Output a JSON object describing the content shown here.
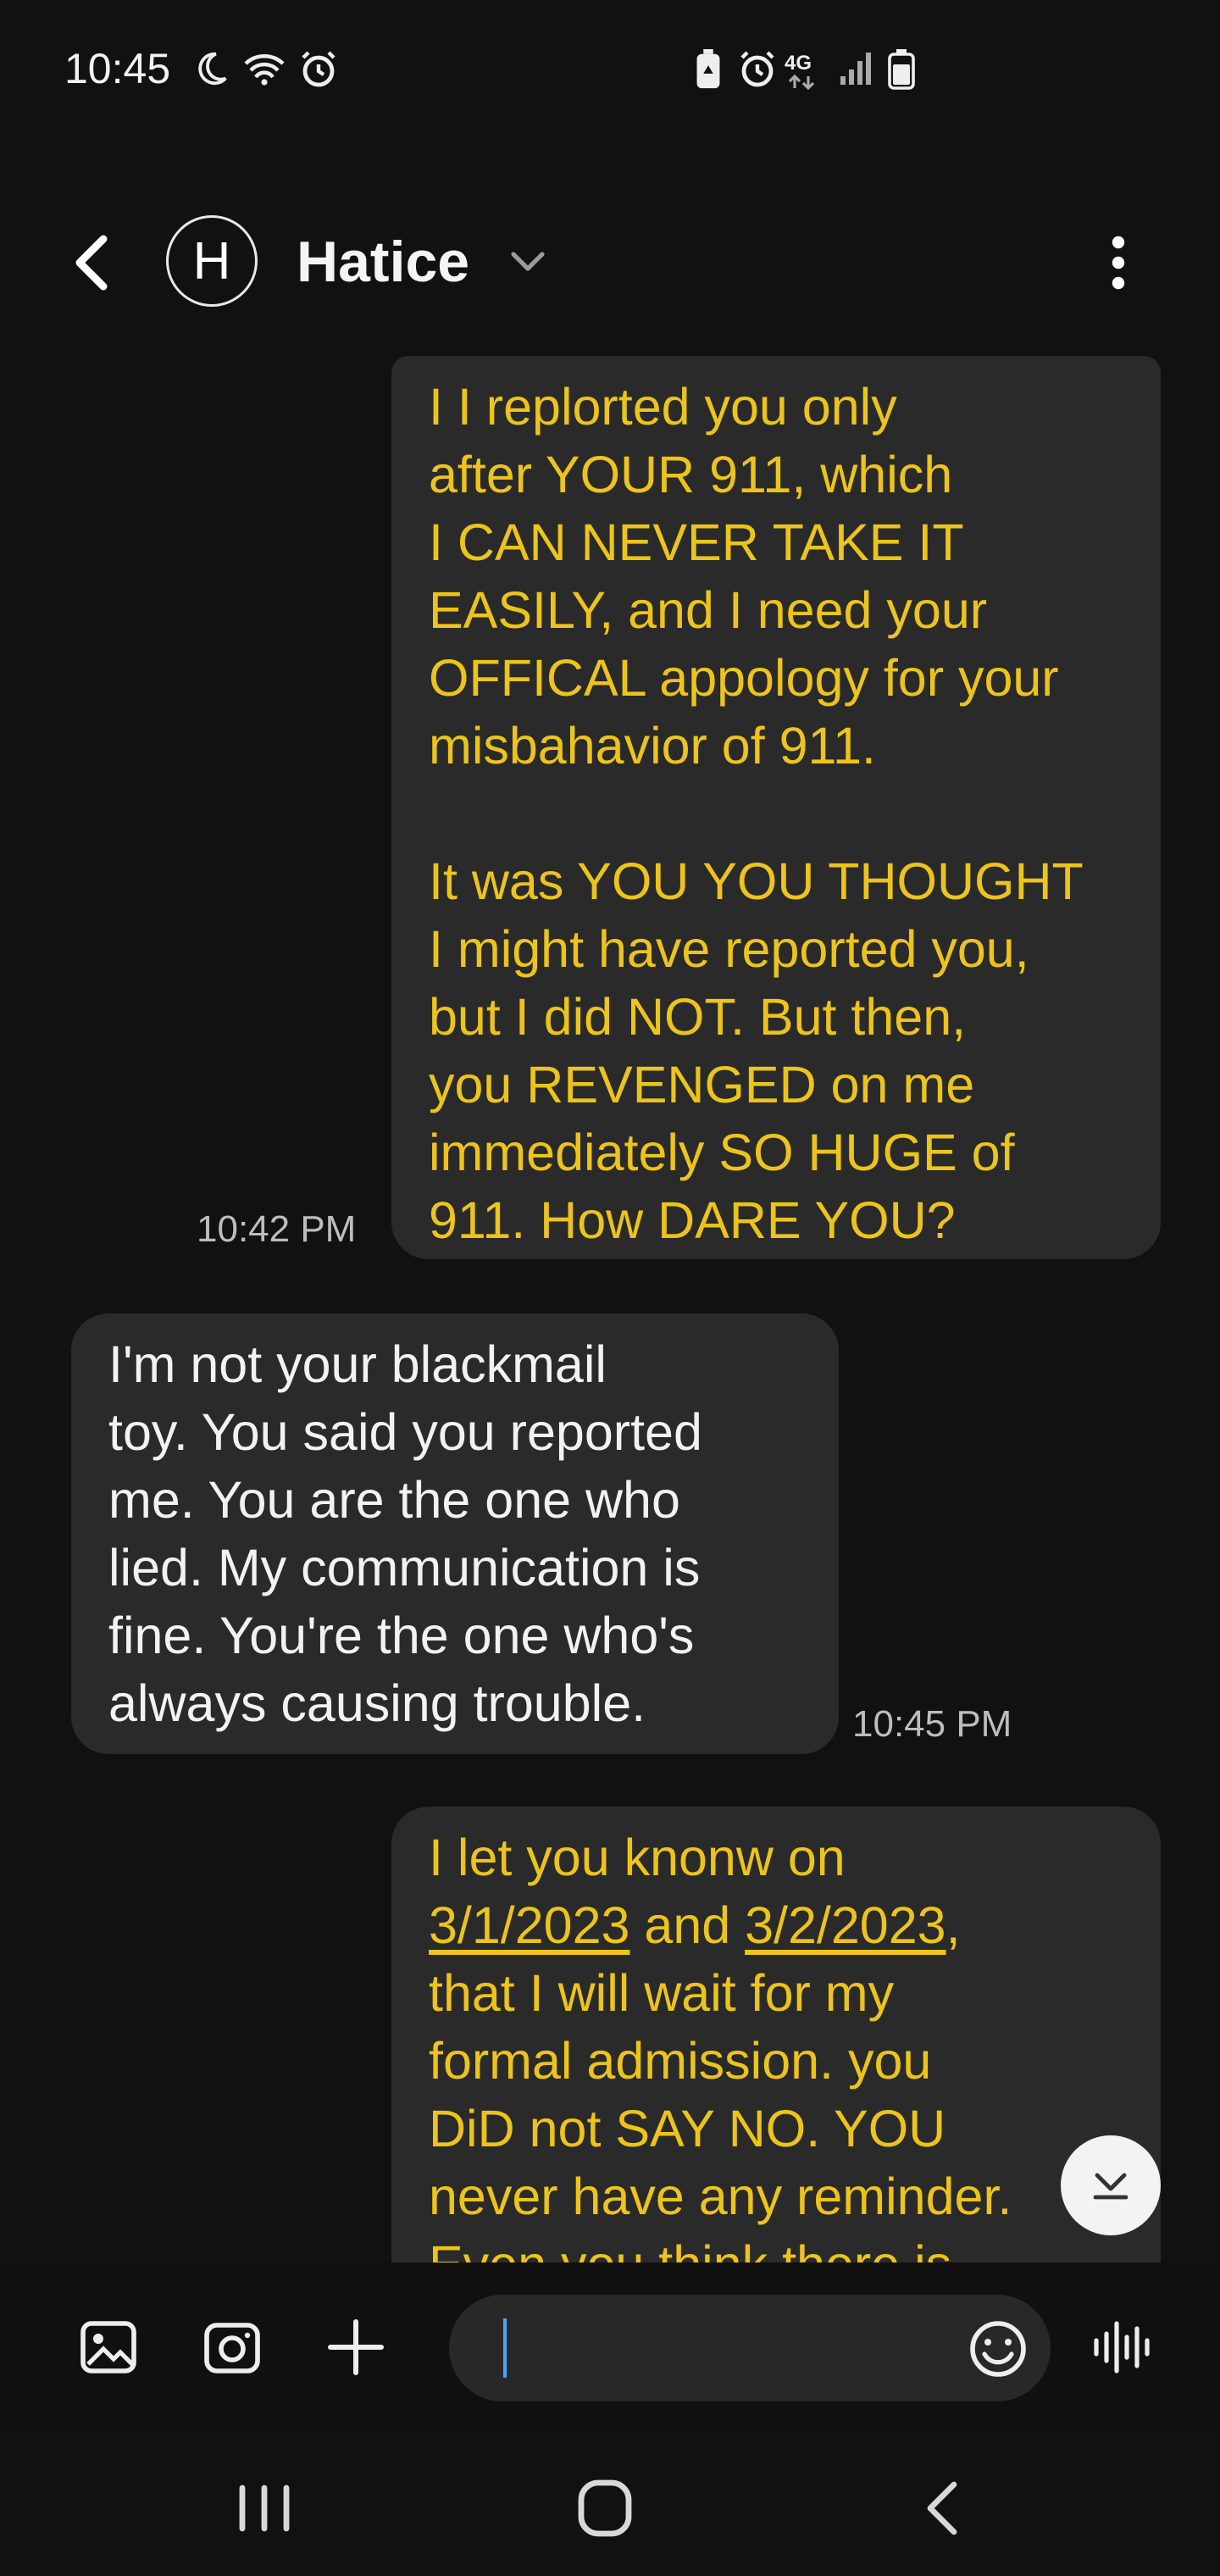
{
  "status_bar": {
    "time": "10:45",
    "left_icons": [
      "moon-icon",
      "wifi-icon",
      "alarm-icon"
    ],
    "right_icons": [
      "battery-saver-icon",
      "alarm-icon",
      "4g-icon",
      "signal-icon",
      "battery-icon"
    ]
  },
  "header": {
    "avatar_initial": "H",
    "contact_name": "Hatice"
  },
  "messages": [
    {
      "direction": "sent",
      "text": "I I replorted you only\nafter YOUR 911, which\nI CAN NEVER TAKE IT\nEASILY, and I need your\nOFFICAL appology for your\nmisbahavior of 911.\n\nIt was YOU YOU THOUGHT\nI might have reported you,\nbut I did NOT. But then,\nyou REVENGED on me\nimmediately SO HUGE of\n911. How DARE YOU?",
      "time": "10:42 PM"
    },
    {
      "direction": "received",
      "text": "I'm not your blackmail\ntoy. You said you reported\nme. You are the one who\nlied. My communication is\nfine. You're the one who's\nalways causing trouble.",
      "time": "10:45 PM"
    },
    {
      "direction": "sent",
      "text_parts": {
        "p1": "I let you knonw on\n",
        "date1": "3/1/2023",
        "p2": " and ",
        "date2": "3/2/2023",
        "p3": ",\nthat I will wait for my\nformal admission. you\nDiD not SAY NO. YOU\nnever have any reminder.\nEven you think there is\nth\nhave NOT being aware"
      }
    }
  ],
  "composer": {
    "placeholder": ""
  },
  "colors": {
    "background": "#111111",
    "bubble": "#2a2a2a",
    "sent_text": "#ecc41b",
    "received_text": "#f2f2f2"
  }
}
